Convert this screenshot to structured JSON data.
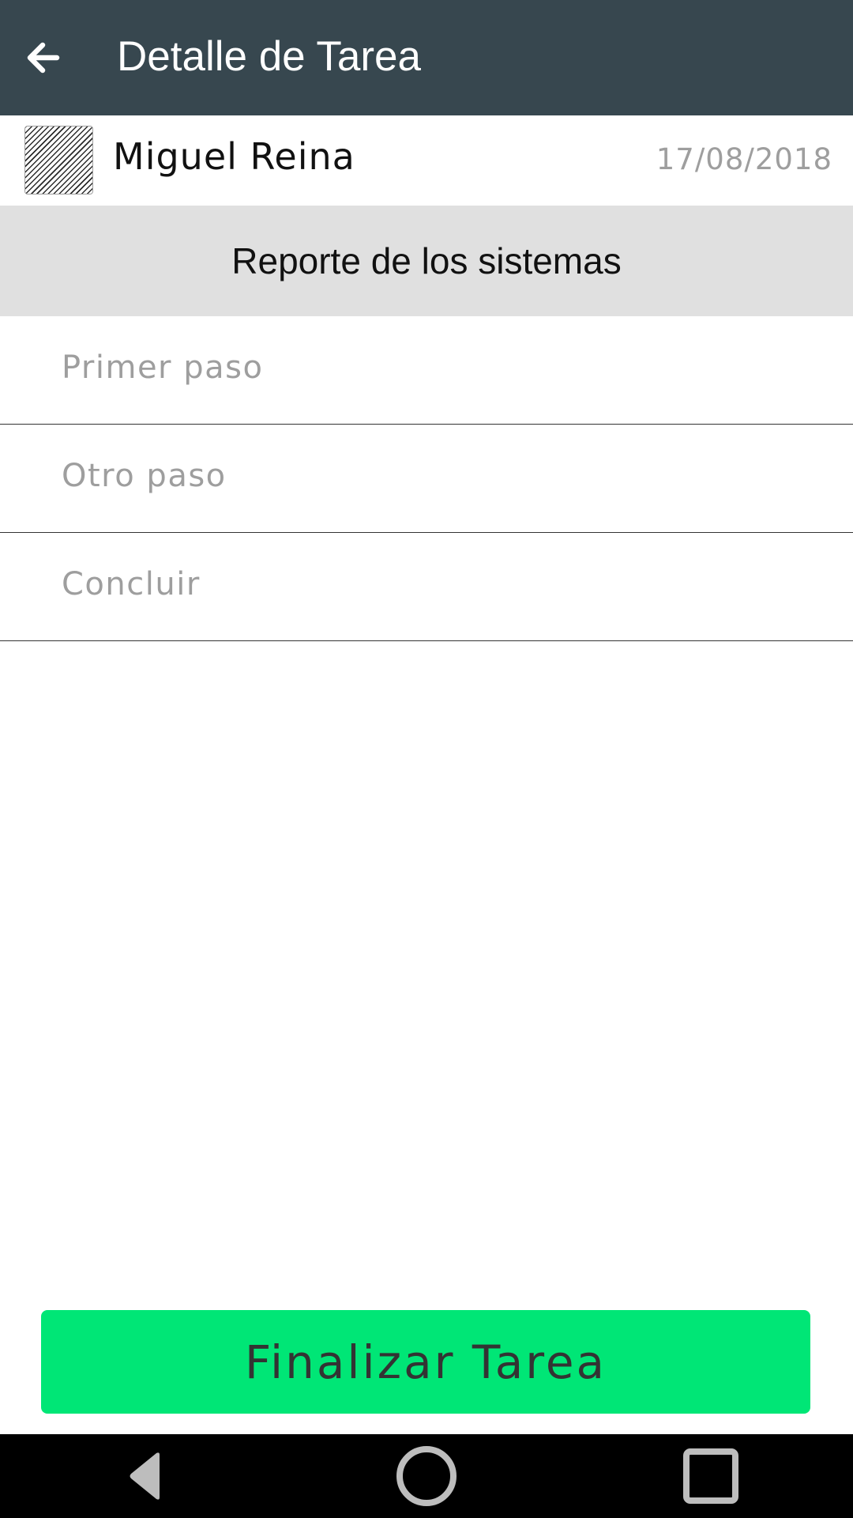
{
  "appbar": {
    "title": "Detalle de Tarea",
    "back_icon": "arrow-left-icon",
    "background_color": "#37474f"
  },
  "task": {
    "user_name": "Miguel Reina",
    "date": "17/08/2018",
    "avatar_icon": "avatar-placeholder",
    "title": "Reporte de los sistemas"
  },
  "steps": [
    {
      "label": "Primer paso"
    },
    {
      "label": "Otro paso"
    },
    {
      "label": "Concluir"
    }
  ],
  "actions": {
    "finish_label": "Finalizar Tarea",
    "finish_color": "#00e676"
  },
  "system_nav": {
    "back_icon": "triangle-back-icon",
    "home_icon": "circle-home-icon",
    "recent_icon": "square-recents-icon"
  }
}
